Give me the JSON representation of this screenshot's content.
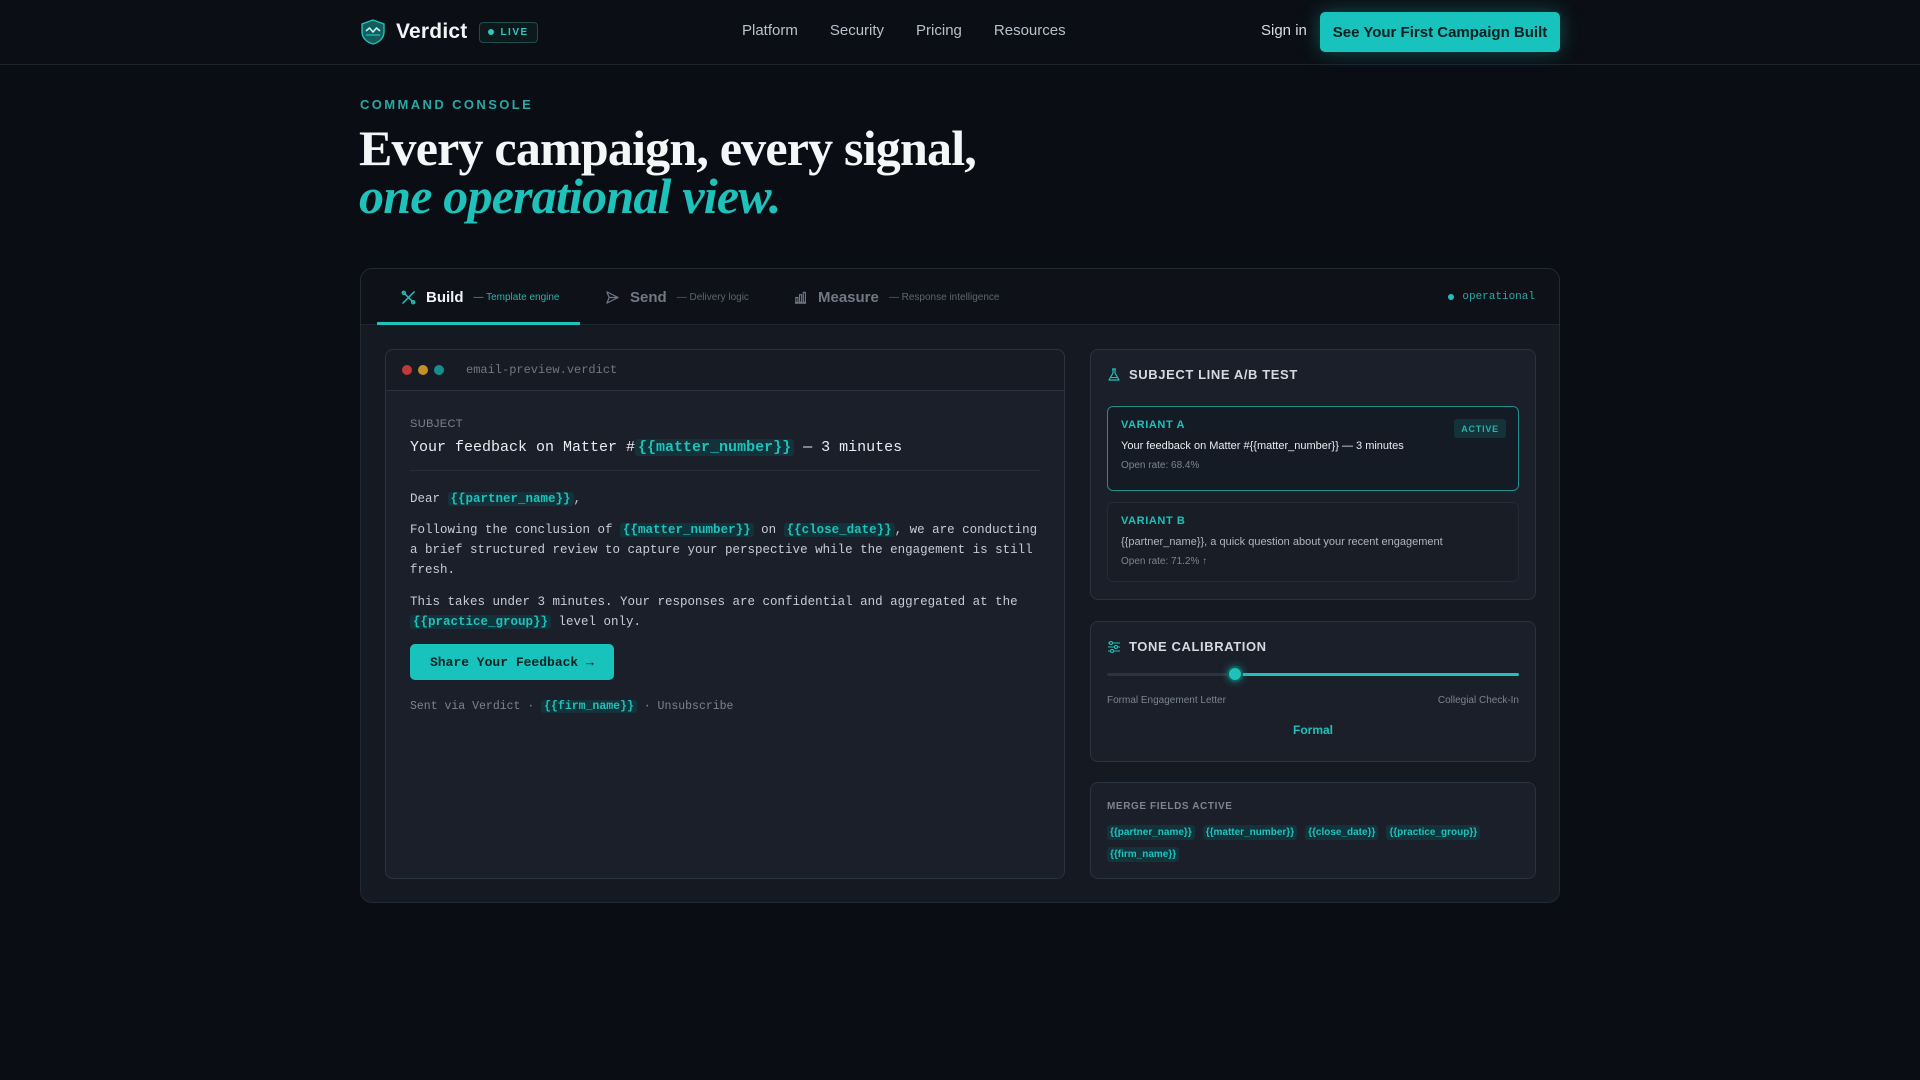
{
  "nav": {
    "brand": "Verdict",
    "live": "LIVE",
    "links": [
      "Platform",
      "Security",
      "Pricing",
      "Resources"
    ],
    "signin": "Sign in",
    "cta": "See Your First Campaign Built"
  },
  "hero": {
    "eyebrow": "COMMAND CONSOLE",
    "line1": "Every campaign, every signal,",
    "line2": "one operational view."
  },
  "console": {
    "tabs": [
      {
        "label": "Build",
        "sub": "— Template engine",
        "icon": "tools-icon",
        "active": true
      },
      {
        "label": "Send",
        "sub": "— Delivery logic",
        "icon": "send-icon",
        "active": false
      },
      {
        "label": "Measure",
        "sub": "— Response intelligence",
        "icon": "bar-chart-icon",
        "active": false
      }
    ],
    "status": "operational",
    "accent": "#1ec2bb"
  },
  "email": {
    "filename": "email-preview.verdict",
    "subject_label": "SUBJECT",
    "subject_prefix": "Your feedback on Matter #",
    "subject_field": "{{matter_number}}",
    "subject_suffix": " — 3 minutes",
    "greeting": "Dear ",
    "greeting_field": "{{partner_name}}",
    "greeting_end": ",",
    "p1_a": "Following the conclusion of ",
    "p1_field1": "{{matter_number}}",
    "p1_b": " on ",
    "p1_field2": "{{close_date}}",
    "p1_c": ", we are conducting a brief structured review to capture your perspective while the engagement is still fresh.",
    "p2_a": "This takes under 3 minutes. Your responses are confidential and aggregated at the ",
    "p2_field": "{{practice_group}}",
    "p2_b": " level only.",
    "button": "Share Your Feedback →",
    "footer_a": "Sent via Verdict · ",
    "footer_field": "{{firm_name}}",
    "footer_b": " · Unsubscribe"
  },
  "abtest": {
    "title": "SUBJECT LINE A/B TEST",
    "variant_a": {
      "label": "VARIANT A",
      "badge": "ACTIVE",
      "text": "Your feedback on Matter #{{matter_number}} — 3 minutes",
      "rate": "Open rate: 68.4%"
    },
    "variant_b": {
      "label": "VARIANT B",
      "text": "{{partner_name}}, a quick question about your recent engagement",
      "rate": "Open rate: 71.2% ↑"
    }
  },
  "tone": {
    "title": "TONE CALIBRATION",
    "left": "Formal Engagement Letter",
    "right": "Collegial Check-In",
    "value": "Formal",
    "position_pct": 31
  },
  "merge_fields": {
    "title": "MERGE FIELDS ACTIVE",
    "fields": [
      "{{partner_name}}",
      "{{matter_number}}",
      "{{close_date}}",
      "{{practice_group}}",
      "{{firm_name}}"
    ]
  }
}
